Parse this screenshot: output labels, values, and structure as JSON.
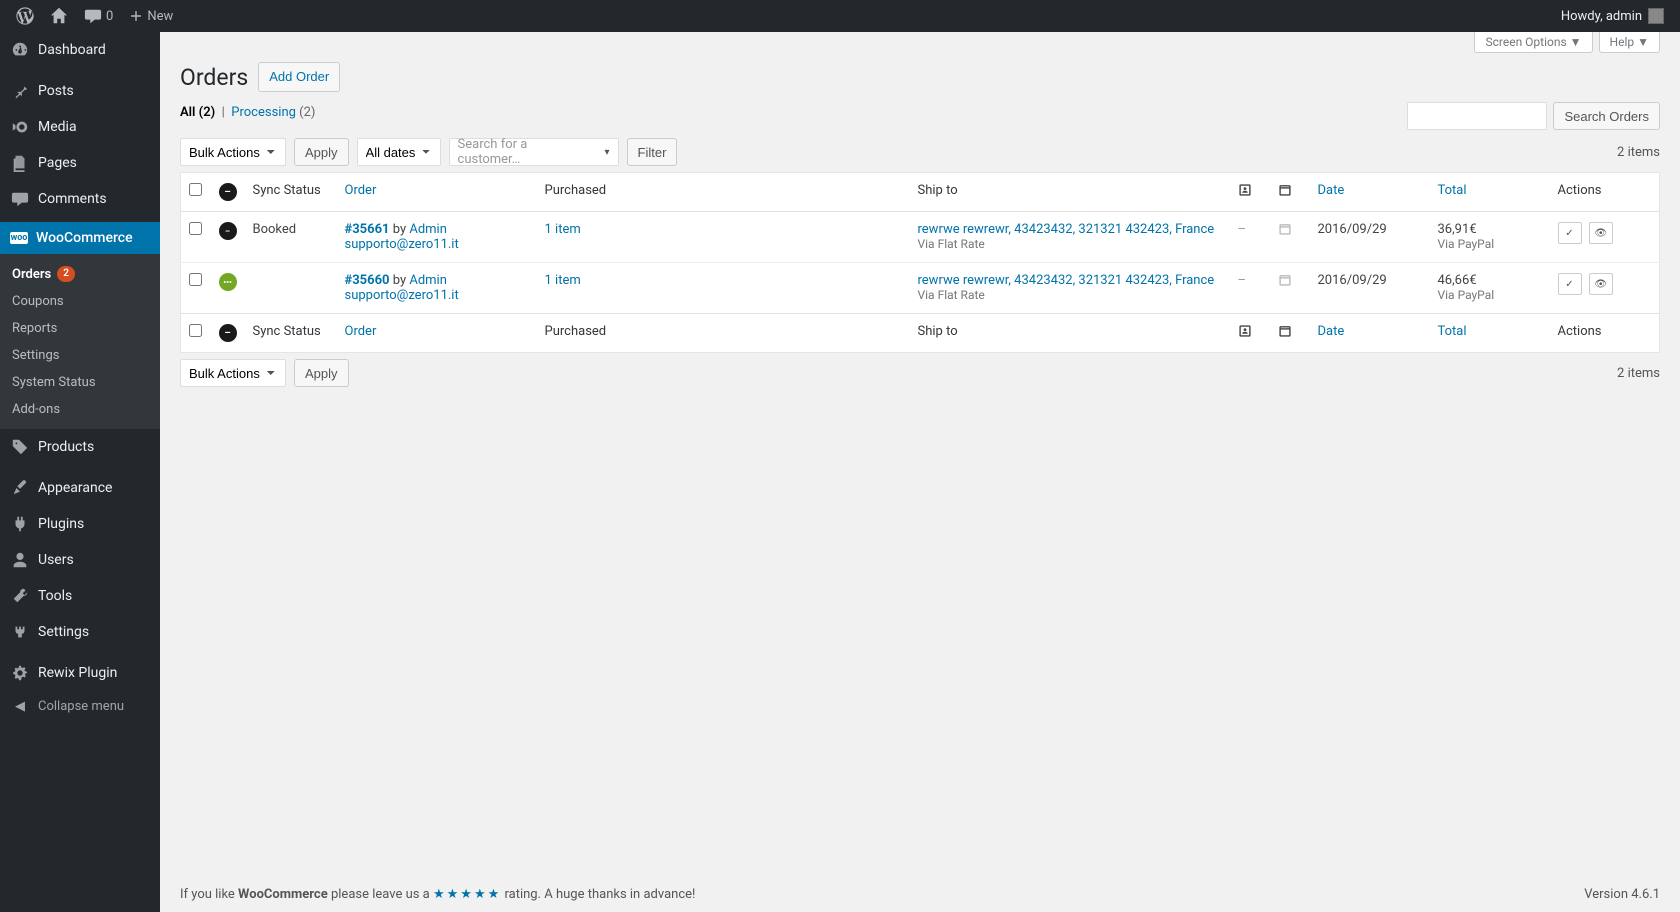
{
  "adminbar": {
    "comment_count": "0",
    "new_label": "New",
    "greeting": "Howdy, admin"
  },
  "sidebar": {
    "dashboard": "Dashboard",
    "posts": "Posts",
    "media": "Media",
    "pages": "Pages",
    "comments": "Comments",
    "woocommerce": "WooCommerce",
    "products": "Products",
    "appearance": "Appearance",
    "plugins": "Plugins",
    "users": "Users",
    "tools": "Tools",
    "settings": "Settings",
    "rewix": "Rewix Plugin",
    "collapse": "Collapse menu",
    "woo_sub": {
      "orders": "Orders",
      "orders_count": "2",
      "coupons": "Coupons",
      "reports": "Reports",
      "settings": "Settings",
      "system_status": "System Status",
      "addons": "Add-ons"
    }
  },
  "screen": {
    "options": "Screen Options",
    "help": "Help"
  },
  "page": {
    "title": "Orders",
    "add_order": "Add Order"
  },
  "filters": {
    "all_label": "All",
    "all_count": "(2)",
    "processing_label": "Processing",
    "processing_count": "(2)"
  },
  "actions": {
    "bulk": "Bulk Actions",
    "apply": "Apply",
    "all_dates": "All dates",
    "search_customer_placeholder": "Search for a customer…",
    "filter": "Filter",
    "search_orders": "Search Orders",
    "items_count": "2 items"
  },
  "columns": {
    "sync_status": "Sync Status",
    "order": "Order",
    "purchased": "Purchased",
    "ship_to": "Ship to",
    "date": "Date",
    "total": "Total",
    "actions": "Actions"
  },
  "orders": [
    {
      "sync": "Booked",
      "status": "booked",
      "number": "#35661",
      "by": "by",
      "user": "Admin",
      "email": "supporto@zero11.it",
      "purchased": "1 item",
      "ship_to": "rewrwe rewrewr, 43423432, 321321 432423, France",
      "ship_via": "Via Flat Rate",
      "customer_note": "–",
      "date": "2016/09/29",
      "total": "36,91€",
      "pay_via": "Via PayPal"
    },
    {
      "sync": "",
      "status": "processing",
      "number": "#35660",
      "by": "by",
      "user": "Admin",
      "email": "supporto@zero11.it",
      "purchased": "1 item",
      "ship_to": "rewrwe rewrewr, 43423432, 321321 432423, France",
      "ship_via": "Via Flat Rate",
      "customer_note": "–",
      "date": "2016/09/29",
      "total": "46,66€",
      "pay_via": "Via PayPal"
    }
  ],
  "footer": {
    "prefix": "If you like ",
    "woo": "WooCommerce",
    "mid": " please leave us a ",
    "stars": "★★★★★",
    "suffix": " rating. A huge thanks in advance!",
    "version": "Version 4.6.1"
  }
}
